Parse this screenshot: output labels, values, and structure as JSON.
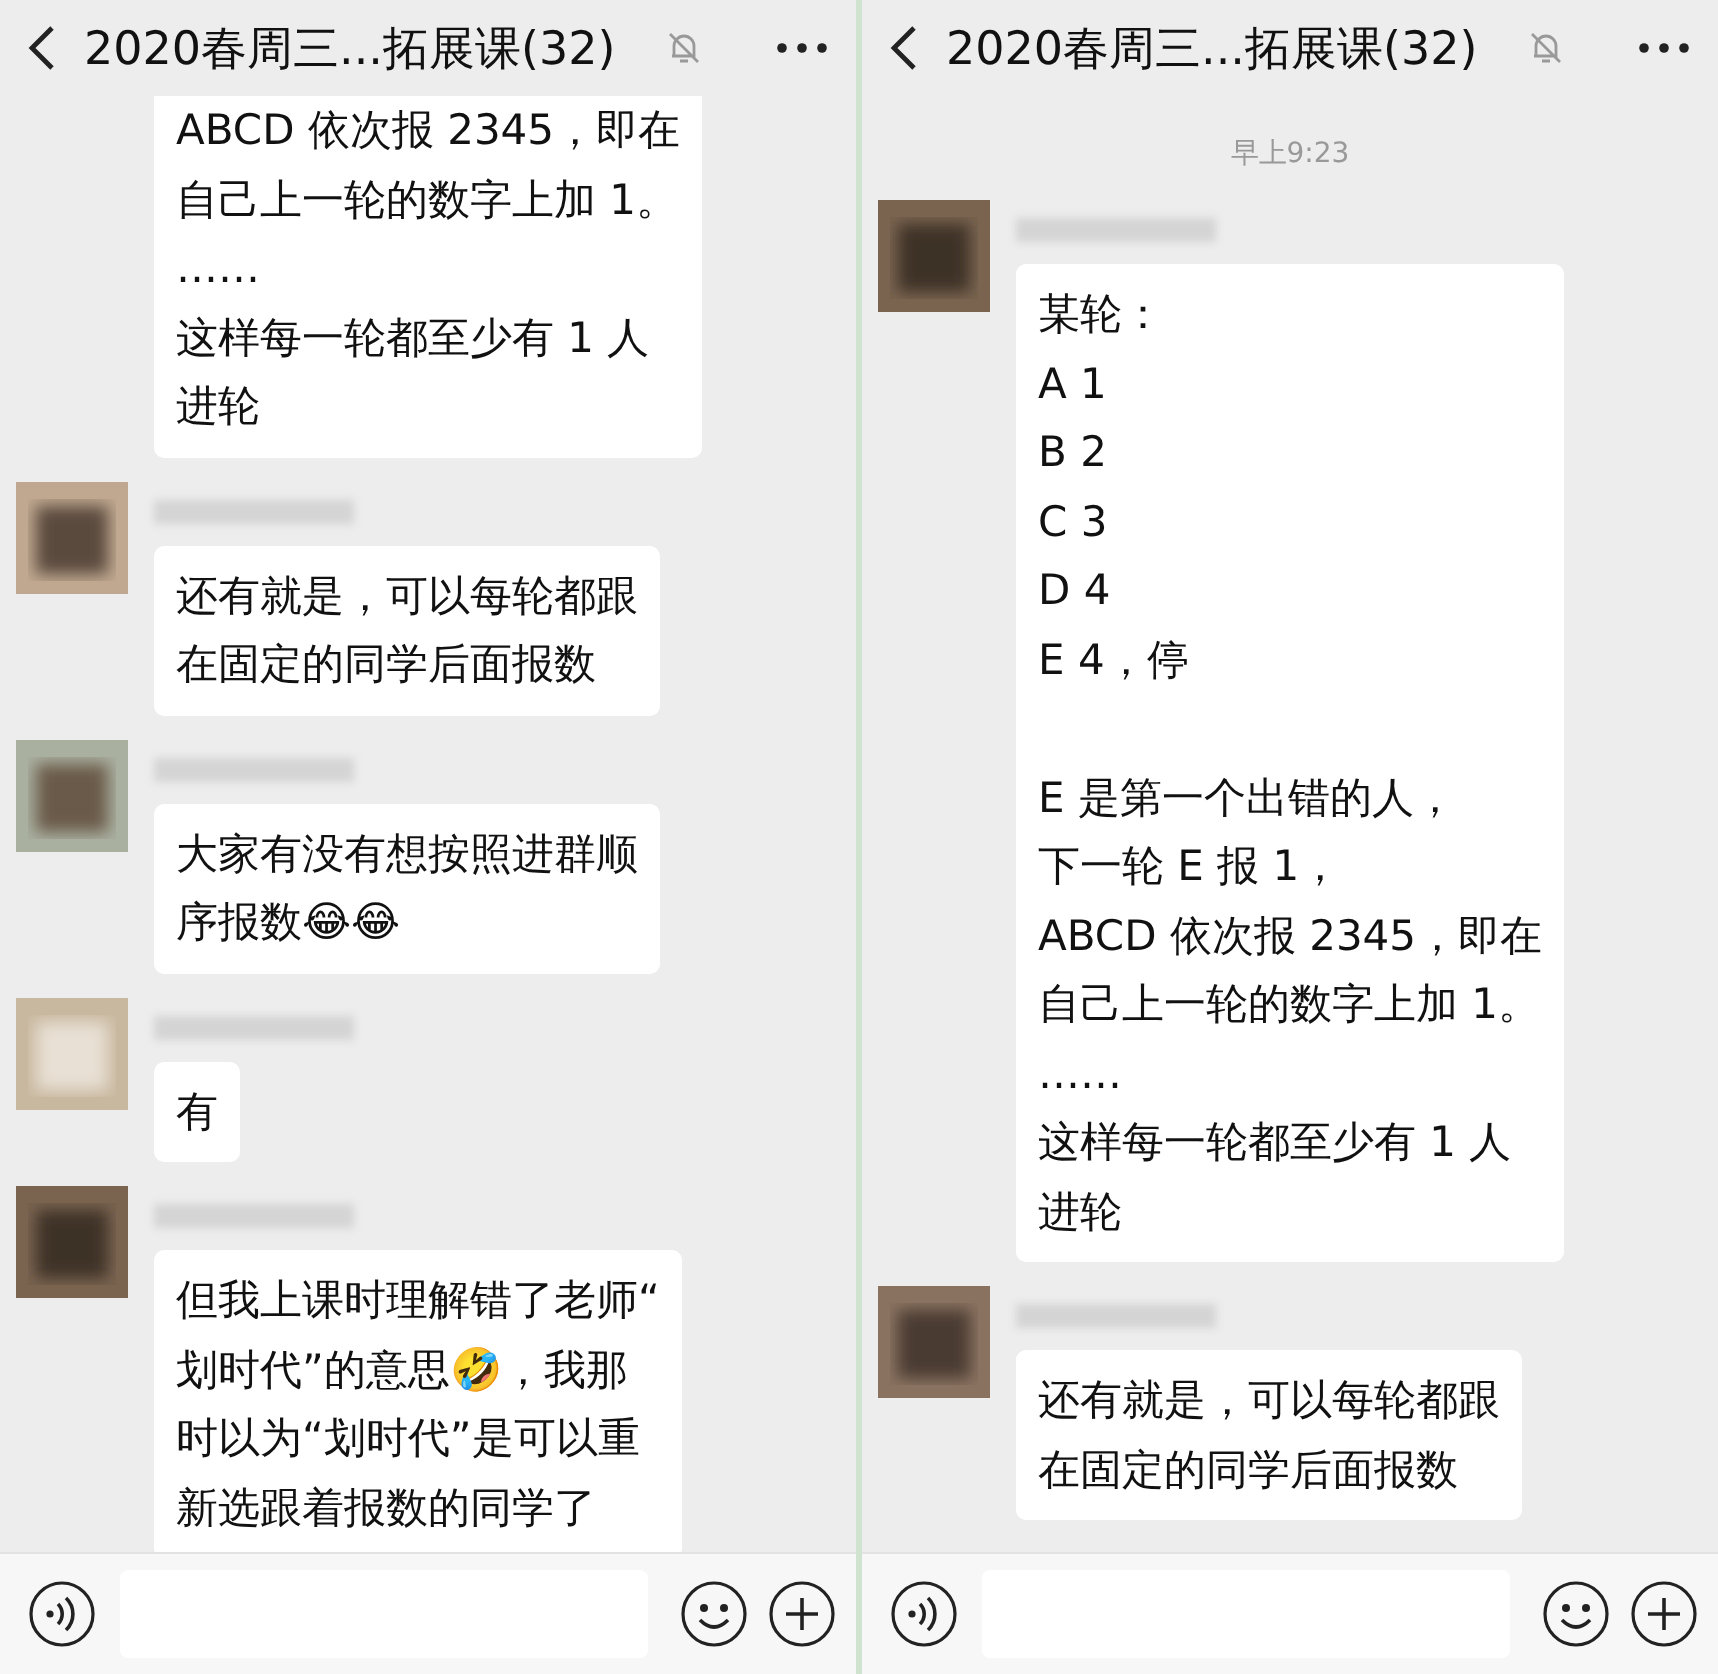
{
  "panels": [
    {
      "title": "2020春周三...拓展课(32)",
      "messages": [
        {
          "kind": "continued",
          "lines": [
            "ABCD 依次报 2345，即在",
            "自己上一轮的数字上加 1。",
            "……",
            "这样每一轮都至少有 1 人",
            "进轮"
          ]
        },
        {
          "kind": "message",
          "lines": [
            "还有就是，可以每轮都跟",
            "在固定的同学后面报数"
          ]
        },
        {
          "kind": "message",
          "lines": [
            "大家有没有想按照进群顺",
            "序报数😂😂"
          ]
        },
        {
          "kind": "message",
          "lines": [
            "有"
          ]
        },
        {
          "kind": "message",
          "lines": [
            "但我上课时理解错了老师“",
            "划时代”的意思🤣，我那",
            "时以为“划时代”是可以重",
            "新选跟着报数的同学了"
          ]
        }
      ]
    },
    {
      "title": "2020春周三...拓展课(32)",
      "messages": [
        {
          "kind": "time",
          "text": "早上9:23"
        },
        {
          "kind": "message",
          "lines": [
            "某轮：",
            "A 1",
            "B 2",
            "C 3",
            "D 4",
            "E 4，停"
          ],
          "more_lines": [
            "E 是第一个出错的人，",
            "下一轮 E 报 1，",
            "ABCD 依次报 2345，即在",
            "自己上一轮的数字上加 1。",
            "……",
            "这样每一轮都至少有 1 人",
            "进轮"
          ]
        },
        {
          "kind": "message",
          "lines": [
            "还有就是，可以每轮都跟",
            "在固定的同学后面报数"
          ]
        }
      ]
    }
  ]
}
